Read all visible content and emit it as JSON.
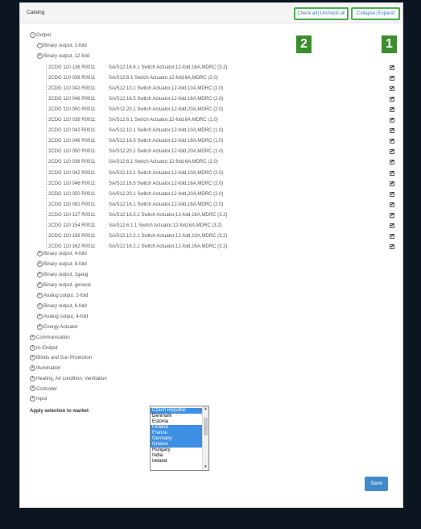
{
  "header": {
    "title": "Catalog",
    "check_all": "Check all",
    "uncheck_all": "Uncheck all",
    "collapse": "Collapse",
    "expand": "Expand",
    "separator": "|"
  },
  "annotations": [
    "2",
    "1"
  ],
  "tree": {
    "root": "Output",
    "groups_before": [
      "Binary output, 2-fold"
    ],
    "expanded_group": "Binary output, 12-fold",
    "leaves": [
      {
        "code": "2CDG 110 136 R0011",
        "desc": "SA/S12.16.6.1 Switch Actuator,12-fold,16A,MDRC (3.2)",
        "checked": "✔"
      },
      {
        "code": "2CDG 110 038 R0011",
        "desc": "SA/S12.6.1 Switch Actuator,12-fold,6A,MDRC (2.0)",
        "checked": "✔"
      },
      {
        "code": "2CDG 110 042 R0011",
        "desc": "SA/S12.10.1 Switch Actuator,12-fold,10A,MDRC (2.0)",
        "checked": "✔"
      },
      {
        "code": "2CDG 110 046 R0011",
        "desc": "SA/S12.16.5 Switch Actuator,12-fold,16A,MDRC (2.0)",
        "checked": "✔"
      },
      {
        "code": "2CDG 110 050 R0011",
        "desc": "SA/S12.20.1 Switch Actuator,12-fold,20A,MDRC (2.0)",
        "checked": "✔"
      },
      {
        "code": "2CDG 110 038 R0011",
        "desc": "SA/S12.6.1 Switch Actuator,12-fold,6A,MDRC (1.0)",
        "checked": "✔"
      },
      {
        "code": "2CDG 110 042 R0011",
        "desc": "SA/S12.10.1 Switch Actuator,12-fold,10A,MDRC (1.0)",
        "checked": "✔"
      },
      {
        "code": "2CDG 110 046 R0011",
        "desc": "SA/S12.16.5 Switch Actuator,12-fold,16A,MDRC (1.0)",
        "checked": "✔"
      },
      {
        "code": "2CDG 110 050 R0011",
        "desc": "SA/S12.20.1 Switch Actuator,12-fold,20A,MDRC (1.0)",
        "checked": "✔"
      },
      {
        "code": "2CDG 110 038 R0011",
        "desc": "SA/S12.6.1 Switch Actuator,12-fold,6A,MDRC (2.0)",
        "checked": "✔"
      },
      {
        "code": "2CDG 110 042 R0011",
        "desc": "SA/S12.10.1 Switch Actuator,12-fold,10A,MDRC (2.0)",
        "checked": "✔"
      },
      {
        "code": "2CDG 110 046 R0011",
        "desc": "SA/S12.16.5 Switch Actuator,12-fold,16A,MDRC (2.0)",
        "checked": "✔"
      },
      {
        "code": "2CDG 110 050 R0011",
        "desc": "SA/S12.20.1 Switch Actuator,12-fold,20A,MDRC (2.0)",
        "checked": "✔"
      },
      {
        "code": "2CDG 110 082 R0011",
        "desc": "SA/S12.16.1 Switch Actuator,12-fold,16A,MDRC (2.0)",
        "checked": "✔"
      },
      {
        "code": "2CDG 110 137 R0011",
        "desc": "SA/S12.16.5.1 Switch Actuator,12-fold,16A,MDRC (3.2)",
        "checked": "✔"
      },
      {
        "code": "2CDG 110 154 R0011",
        "desc": "SA/S12.6.1.1 Switch Actuator,12-fold,6A,MDRC (3.2)",
        "checked": "✔"
      },
      {
        "code": "2CDG 110 158 R0011",
        "desc": "SA/S12.10.2.1 Switch Actuator,12-fold,10A,MDRC (3.2)",
        "checked": "✔"
      },
      {
        "code": "2CDG 110 162 R0011",
        "desc": "SA/S12.16.2.1 Switch Actuator,12-fold,16A,MDRC (3.2)",
        "checked": "✔"
      }
    ],
    "groups_after": [
      "Binary output, 4-fold",
      "Binary output, 8-fold",
      "Binary output, 1gang",
      "Binary output, general",
      "Analog output, 2-fold",
      "Binary output, 6-fold",
      "Analog output, 4-fold",
      "Energy Actuator"
    ],
    "top_level": [
      "Communication",
      "In-/Output",
      "Blinds and Sun Protection",
      "Illumination",
      "Heating, Air condition, Ventilation",
      "Controller",
      "Input"
    ],
    "minus_sign": "⊟",
    "plus_sign": "⊞"
  },
  "market": {
    "label": "Apply selection to market",
    "options": [
      {
        "name": "Czech Republic",
        "selected": true
      },
      {
        "name": "Denmark",
        "selected": false
      },
      {
        "name": "Estonia",
        "selected": false
      },
      {
        "name": "Finland",
        "selected": true
      },
      {
        "name": "France",
        "selected": true
      },
      {
        "name": "Germany",
        "selected": true
      },
      {
        "name": "Greece",
        "selected": true
      },
      {
        "name": "Hungary",
        "selected": false
      },
      {
        "name": "India",
        "selected": false
      },
      {
        "name": "Ireland",
        "selected": false
      }
    ]
  },
  "save_label": "Save",
  "colors": {
    "accent_green": "#3d8c2e",
    "selection_blue": "#3d8fe3",
    "button_blue": "#428bca"
  }
}
